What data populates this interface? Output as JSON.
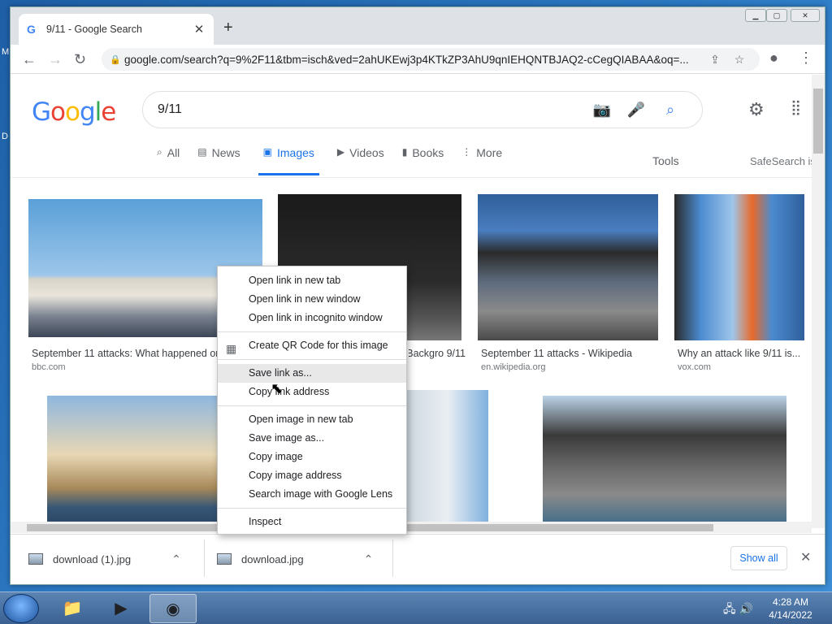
{
  "desktop": {
    "left_glyph_1": "M",
    "left_glyph_2": "D"
  },
  "browser": {
    "tab_title": "9/11 - Google Search",
    "tab_favicon": "G",
    "new_tab": "+",
    "url": "google.com/search?q=9%2F11&tbm=isch&ved=2ahUKEwj3p4KTkZP3AhU9qnIEHQNTBJAQ2-cCegQIABAA&oq=..."
  },
  "google": {
    "logo": "Google",
    "query": "9/11",
    "tabs": [
      {
        "icon": "search-icon",
        "label": "All"
      },
      {
        "icon": "news-icon",
        "label": "News"
      },
      {
        "icon": "images-icon",
        "label": "Images"
      },
      {
        "icon": "videos-icon",
        "label": "Videos"
      },
      {
        "icon": "books-icon",
        "label": "Books"
      },
      {
        "icon": "more-icon",
        "label": "More"
      }
    ],
    "tools": "Tools",
    "safesearch": "SafeSearch is on"
  },
  "results": [
    {
      "caption": "September 11 attacks: What happened on 9/11",
      "source": "bbc.com"
    },
    {
      "caption": "9/11 Wallpapers, Backgro...",
      "source": ""
    },
    {
      "caption": "September 11 attacks - Wikipedia",
      "source": "en.wikipedia.org"
    },
    {
      "caption": "Why an attack like 9/11 is...",
      "source": "vox.com"
    }
  ],
  "context_menu": {
    "open_new_tab": "Open link in new tab",
    "open_new_window": "Open link in new window",
    "open_incognito": "Open link in incognito window",
    "create_qr": "Create QR Code for this image",
    "save_link_as": "Save link as...",
    "copy_link_address": "Copy link address",
    "open_image_new_tab": "Open image in new tab",
    "save_image_as": "Save image as...",
    "copy_image": "Copy image",
    "copy_image_address": "Copy image address",
    "search_lens": "Search image with Google Lens",
    "inspect": "Inspect"
  },
  "downloads": {
    "items": [
      {
        "name": "download (1).jpg"
      },
      {
        "name": "download.jpg"
      }
    ],
    "show_all": "Show all"
  },
  "taskbar": {
    "time": "4:28 AM",
    "date": "4/14/2022"
  }
}
